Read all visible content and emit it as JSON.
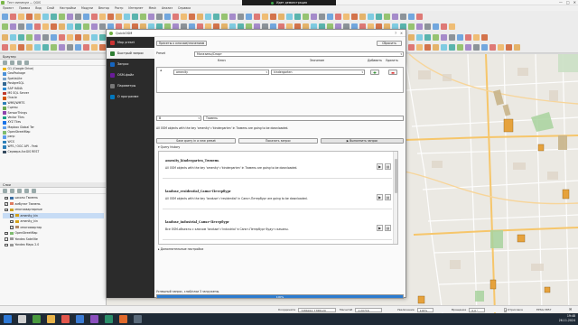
{
  "app": {
    "title": "Тест минимум — QGIS",
    "window_controls": [
      "—",
      "□",
      "✕"
    ],
    "demo_banner": "Идет демонстрация"
  },
  "menu": [
    "Проект",
    "Правка",
    "Вид",
    "Слой",
    "Настройки",
    "Модули",
    "Вектор",
    "Растр",
    "Интернет",
    "Mesh",
    "Анализ",
    "Справка"
  ],
  "dock": {
    "browser_title": "Браузер",
    "browser_items": [
      {
        "label": "G1 (Google Drive)",
        "color": "#f0b400"
      },
      {
        "label": "GeoPackage",
        "color": "#4a90d9"
      },
      {
        "label": "SpatiaLite",
        "color": "#7aa2c8"
      },
      {
        "label": "PostgreSQL",
        "color": "#336791"
      },
      {
        "label": "SAP HANA",
        "color": "#2d8bd6"
      },
      {
        "label": "MS SQL Server",
        "color": "#c0392b"
      },
      {
        "label": "Oracle",
        "color": "#d35400"
      },
      {
        "label": "WMS/WMTS",
        "color": "#2c7fb8"
      },
      {
        "label": "Сцены",
        "color": "#6aa84f"
      },
      {
        "label": "SensorThings",
        "color": "#8e44ad"
      },
      {
        "label": "Vector Tiles",
        "color": "#16a085"
      },
      {
        "label": "XYZ Tiles",
        "color": "#1a73e8"
      },
      {
        "label": "Mapbox Global Ter",
        "color": "#5d9cec"
      },
      {
        "label": "OpenStreetMap",
        "color": "#7ebc6f"
      },
      {
        "label": "pxnp",
        "color": "#5d9cec"
      },
      {
        "label": "WCS",
        "color": "#2c7fb8"
      },
      {
        "label": "WFS / OGC API - Feat",
        "color": "#2c7fb8"
      },
      {
        "label": "Сервера ArcGIS REST",
        "color": "#34495e"
      }
    ],
    "layers_title": "Слои",
    "layers": [
      {
        "label": "школы Тюмень",
        "checked": true,
        "color": "#3a6ea5",
        "selected": false
      },
      {
        "label": "амбулат Тюмень",
        "checked": true,
        "color": "#e07a5f",
        "selected": false
      },
      {
        "label": "многоквартирные",
        "checked": true,
        "color": "#c9a227",
        "selected": false
      },
      {
        "label": "amenity_kin",
        "checked": true,
        "color": "#d4a017",
        "selected": true
      },
      {
        "label": "amenity_kin",
        "checked": true,
        "color": "#d4a017",
        "selected": false
      },
      {
        "label": "многоквартир",
        "checked": true,
        "color": "#b08968",
        "selected": false
      },
      {
        "label": "OpenStreetMap",
        "checked": true,
        "color": "#7ebc6f",
        "selected": false
      },
      {
        "label": "Yandex Satellite",
        "checked": false,
        "color": "#999999",
        "selected": false
      },
      {
        "label": "Yandex Maps 2.0",
        "checked": false,
        "color": "#999999",
        "selected": false
      }
    ]
  },
  "dialog": {
    "title": "QuickOSM",
    "window_controls": [
      "?",
      "✕"
    ],
    "sidebar": [
      {
        "label": "Map preset",
        "icon_color": "#cc3333",
        "active": false
      },
      {
        "label": "Быстрый запрос",
        "icon_color": "#2e7d32",
        "active": true
      },
      {
        "label": "Запрос",
        "icon_color": "#1565c0",
        "active": false
      },
      {
        "label": "OSM-файл",
        "icon_color": "#6a1b9a",
        "active": false
      },
      {
        "label": "Параметры",
        "icon_color": "#777777",
        "active": false
      },
      {
        "label": "О программе",
        "icon_color": "#0277bd",
        "active": false
      }
    ],
    "preset_button": "Пресеты к ключам/значениям",
    "reset_button": "Сбросить",
    "preset_label": "Preset",
    "preset_value": "Магазины/Спорт",
    "col_key": "Ключ",
    "col_value": "Значение",
    "col_add": "Добавить",
    "col_delete": "Удалить",
    "key_value": "amenity",
    "value_value": "kindergarten",
    "in_label": "В",
    "place_value": "Тюмень",
    "description": "All OSM objects with the key 'amenity'='kindergarten' in Тюмень are going to be downloaded.",
    "save_query_button": "Save query in a new preset",
    "show_query_button": "Показать запрос",
    "run_query_button": "Выполнить запрос",
    "history_title": "Query history",
    "history": [
      {
        "title": "amenity_kindergarten_Тюмень",
        "desc": "All OSM objects with the key 'amenity'='kindergarten' in Тюмень are going to be downloaded."
      },
      {
        "title": "landuse_residential_Санкт-Петербург",
        "desc": "All OSM objects with the key 'landuse'='residential' in Санкт-Петербург are going to be downloaded."
      },
      {
        "title": "landuse_industrial_Санкт-Петербург",
        "desc": "Все OSM-объекты с ключом 'landuse'='industrial' в Санкт-Петербург будут скачаны."
      }
    ],
    "advanced_label": "Дополнительные настройки",
    "status_message": "Успешный запрос, слой/слои 3 загружены.",
    "progress": 100,
    "progress_label": "100%"
  },
  "statusbar": {
    "coord_label": "Координата",
    "coord_value": "7286912 7788129",
    "scale_label": "Масштаб",
    "scale_value": "1:20716",
    "magnifier_label": "Увеличение",
    "magnifier_value": "100%",
    "rotation_label": "Вращение",
    "rotation_value": "0,0 °",
    "render_label": "Отрисовка",
    "crs": "EPSG:3857"
  },
  "taskbar": {
    "time": "19:48",
    "date": "26.11.2024"
  }
}
